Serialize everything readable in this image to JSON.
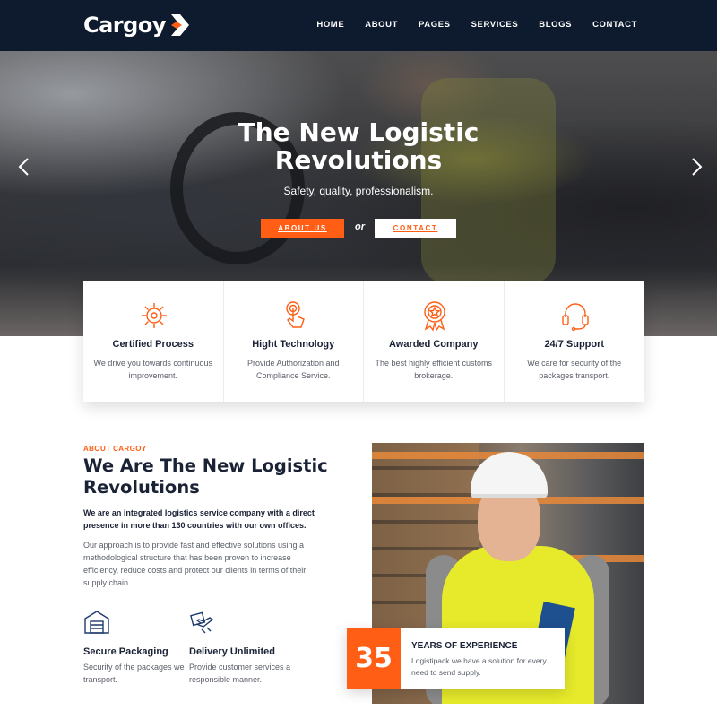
{
  "brand": {
    "name": "Cargoy",
    "accent": "#ff5e14",
    "nav_bg": "#0e1a2e"
  },
  "nav": {
    "items": [
      "HOME",
      "ABOUT",
      "PAGES",
      "SERVICES",
      "BLOGS",
      "CONTACT"
    ]
  },
  "hero": {
    "title": "The New Logistic Revolutions",
    "subtitle": "Safety, quality, professionalism.",
    "primary_button": "ABOUT US",
    "or_text": "or",
    "secondary_button": "CONTACT"
  },
  "features": [
    {
      "icon": "gear-chip-icon",
      "title": "Certified Process",
      "text": "We drive you towards continuous improvement."
    },
    {
      "icon": "touch-hand-icon",
      "title": "Hight Technology",
      "text": "Provide Authorization and Compliance Service."
    },
    {
      "icon": "award-medal-icon",
      "title": "Awarded Company",
      "text": "The best highly efficient customs brokerage."
    },
    {
      "icon": "headset-icon",
      "title": "24/7 Support",
      "text": "We care for security of the packages transport."
    }
  ],
  "about": {
    "eyebrow": "ABOUT CARGOY",
    "title": "We Are The New Logistic Revolutions",
    "lead": "We are an integrated logistics service company with a direct presence in more than 130 countries with our own offices.",
    "body": "Our approach is to provide fast and effective solutions using a methodological structure that has been proven to increase efficiency, reduce costs and protect our clients in terms of their supply chain.",
    "items": [
      {
        "icon": "warehouse-icon",
        "title": "Secure Packaging",
        "text": "Security of the packages we transport."
      },
      {
        "icon": "delivery-plane-box-icon",
        "title": "Delivery Unlimited",
        "text": "Provide customer services a responsible manner."
      }
    ]
  },
  "experience": {
    "number": "35",
    "title": "YEARS OF EXPERIENCE",
    "text": "Logistipack we have a solution for every need to send supply."
  }
}
